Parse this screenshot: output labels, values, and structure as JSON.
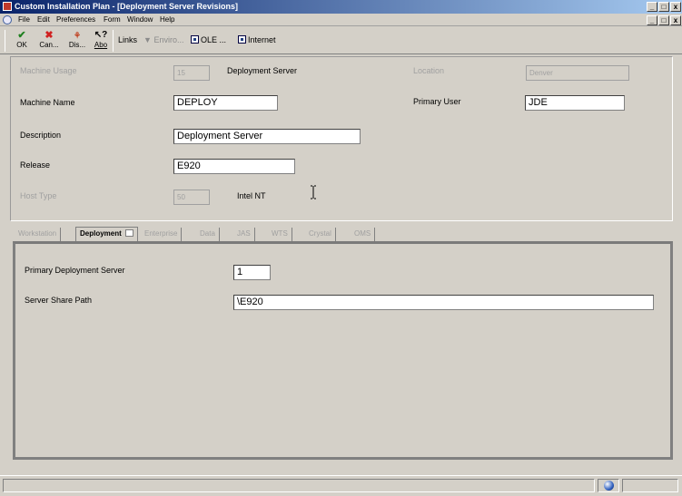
{
  "window": {
    "title": "Custom Installation Plan - [Deployment Server Revisions]"
  },
  "menu": [
    "File",
    "Edit",
    "Preferences",
    "Form",
    "Window",
    "Help"
  ],
  "toolbar": {
    "ok": "OK",
    "cancel": "Can...",
    "display": "Dis...",
    "about": "Abo",
    "links": "Links",
    "environment": "Enviro...",
    "ole": "OLE ...",
    "internet": "Internet"
  },
  "form": {
    "machine_usage_label": "Machine Usage",
    "machine_usage_value": "15",
    "machine_usage_desc": "Deployment Server",
    "location_label": "Location",
    "location_value": "Denver",
    "machine_name_label": "Machine Name",
    "machine_name_value": "DEPLOY",
    "primary_user_label": "Primary User",
    "primary_user_value": "JDE",
    "description_label": "Description",
    "description_value": "Deployment Server",
    "release_label": "Release",
    "release_value": "E920",
    "host_type_label": "Host Type",
    "host_type_value": "50",
    "host_type_desc": "Intel NT"
  },
  "tabs": [
    "Workstation",
    "Deployment",
    "Enterprise",
    "Data",
    "JAS",
    "WTS",
    "Crystal",
    "OMS"
  ],
  "deployment_tab": {
    "primary_label": "Primary Deployment Server",
    "primary_value": "1",
    "share_path_label": "Server Share Path",
    "share_path_value": "\\E920"
  }
}
